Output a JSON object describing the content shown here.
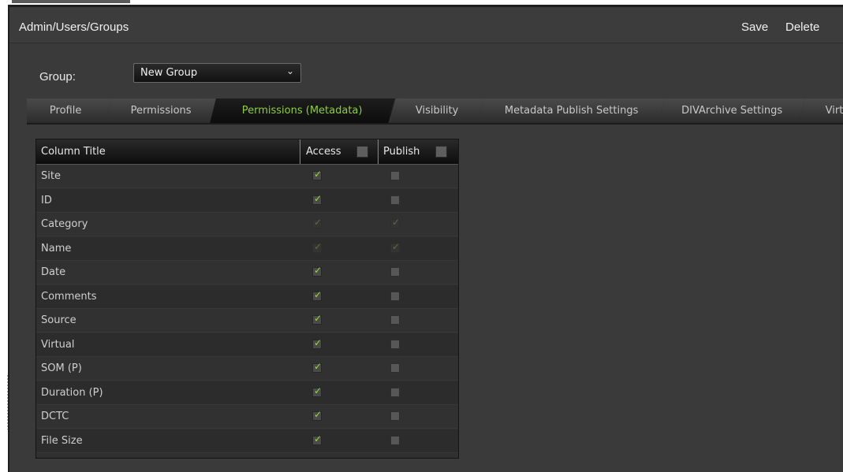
{
  "header": {
    "breadcrumb": "Admin/Users/Groups",
    "save_label": "Save",
    "delete_label": "Delete"
  },
  "group": {
    "label": "Group:",
    "selected": "New Group"
  },
  "tabs": [
    {
      "label": "Profile",
      "active": false
    },
    {
      "label": "Permissions",
      "active": false
    },
    {
      "label": "Permissions (Metadata)",
      "active": true
    },
    {
      "label": "Visibility",
      "active": false
    },
    {
      "label": "Metadata Publish Settings",
      "active": false
    },
    {
      "label": "DIVArchive Settings",
      "active": false
    },
    {
      "label": "Virtu",
      "active": false
    }
  ],
  "table": {
    "columns": [
      "Column Title",
      "Access",
      "Publish"
    ],
    "rows": [
      {
        "title": "Site",
        "access": "checked",
        "publish": "unchecked"
      },
      {
        "title": "ID",
        "access": "checked",
        "publish": "unchecked"
      },
      {
        "title": "Category",
        "access": "disabled-checked",
        "publish": "disabled-checked"
      },
      {
        "title": "Name",
        "access": "disabled-checked",
        "publish": "disabled-checked"
      },
      {
        "title": "Date",
        "access": "checked",
        "publish": "unchecked"
      },
      {
        "title": "Comments",
        "access": "checked",
        "publish": "unchecked"
      },
      {
        "title": "Source",
        "access": "checked",
        "publish": "unchecked"
      },
      {
        "title": "Virtual",
        "access": "checked",
        "publish": "unchecked"
      },
      {
        "title": "SOM (P)",
        "access": "checked",
        "publish": "unchecked"
      },
      {
        "title": "Duration (P)",
        "access": "checked",
        "publish": "unchecked"
      },
      {
        "title": "DCTC",
        "access": "checked",
        "publish": "unchecked"
      },
      {
        "title": "File Size",
        "access": "checked",
        "publish": "unchecked"
      }
    ]
  },
  "colors": {
    "accent": "#8fcf3a",
    "panel": "#3a3a3a",
    "check": "#9bd83f"
  },
  "icons": {
    "dropdown": "chevron-down-icon",
    "checkbox": "checkmark-icon"
  }
}
